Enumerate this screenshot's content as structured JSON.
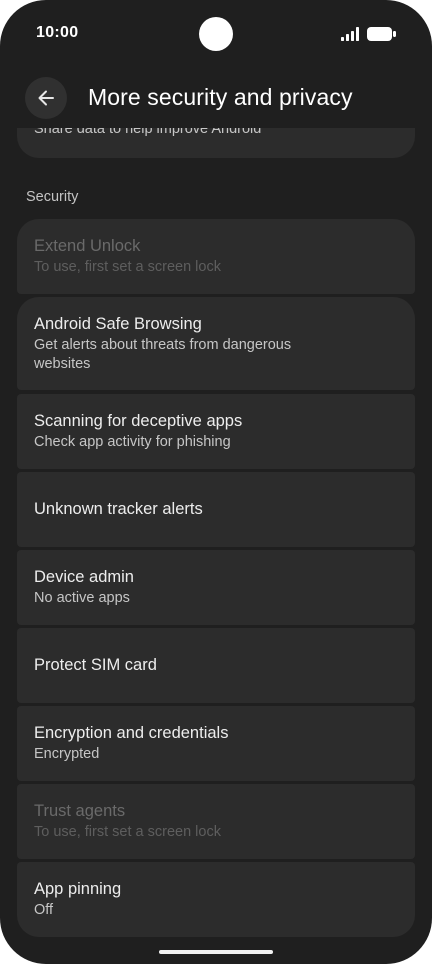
{
  "status_bar": {
    "time": "10:00",
    "icons": [
      "signal-icon",
      "battery-icon"
    ]
  },
  "header": {
    "back_icon": "arrow-left-icon",
    "title": "More security and privacy"
  },
  "top_card": {
    "summary": "Share data to help improve Android"
  },
  "security": {
    "header": "Security",
    "items": [
      {
        "title": "Extend Unlock",
        "summary": "To use, first set a screen lock",
        "disabled": true
      },
      {
        "title": "Android Safe Browsing",
        "summary": "Get alerts about threats from dangerous websites"
      },
      {
        "title": "Scanning for deceptive apps",
        "summary": "Check app activity for phishing"
      },
      {
        "title": "Unknown tracker alerts"
      },
      {
        "title": "Device admin",
        "summary": "No active apps"
      },
      {
        "title": "Protect SIM card"
      },
      {
        "title": "Encryption and credentials",
        "summary": "Encrypted"
      },
      {
        "title": "Trust agents",
        "summary": "To use, first set a screen lock",
        "disabled": true
      },
      {
        "title": "App pinning",
        "summary": "Off"
      }
    ]
  },
  "colors": {
    "background": "#1f1f1f",
    "card": "#2c2c2c",
    "text_primary": "#ededed",
    "text_secondary": "#c6c6c6",
    "text_disabled": "#6a6a6a"
  }
}
